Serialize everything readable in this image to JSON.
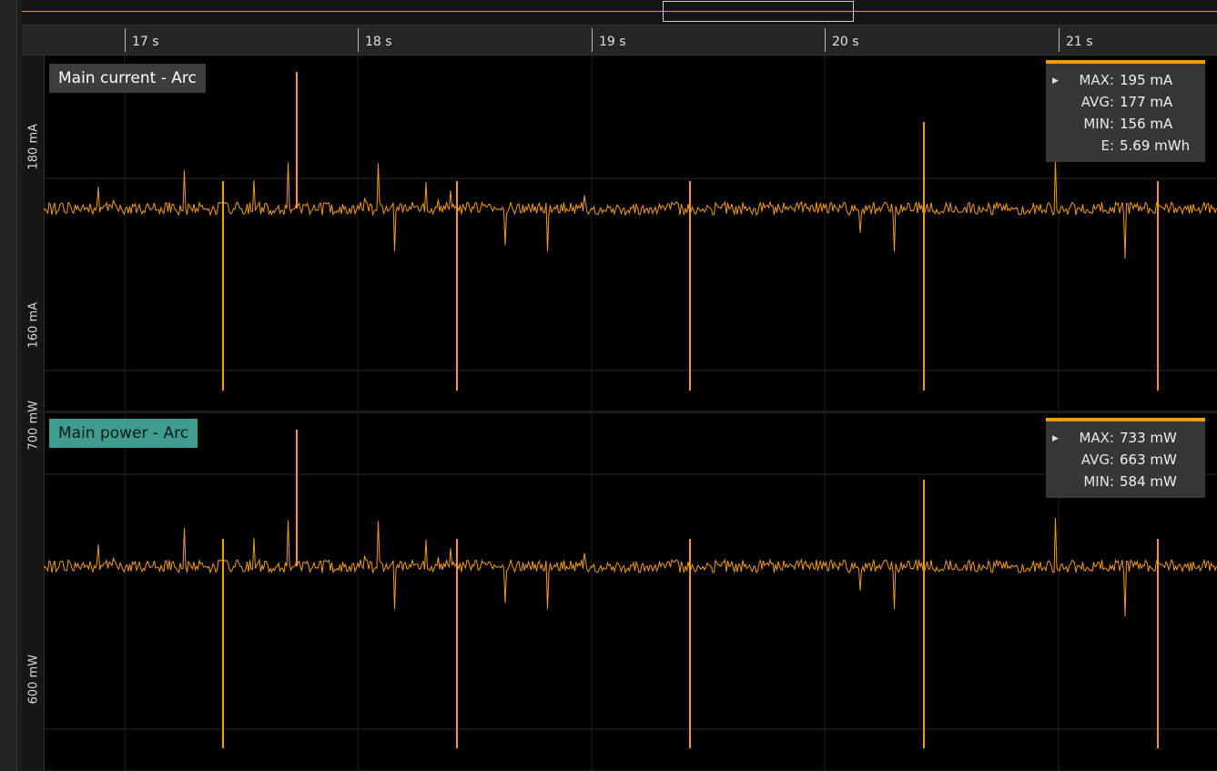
{
  "timeline": {
    "ticks": [
      "17 s",
      "18 s",
      "19 s",
      "20 s",
      "21 s"
    ]
  },
  "panels": [
    {
      "title": "Main current - Arc",
      "y_labels": [
        "180 mA",
        "160 mA"
      ],
      "stats": [
        {
          "key": "MAX:",
          "value": "195 mA"
        },
        {
          "key": "AVG:",
          "value": "177 mA"
        },
        {
          "key": "MIN:",
          "value": "156 mA"
        },
        {
          "key": "E:",
          "value": "5.69 mWh"
        }
      ]
    },
    {
      "title": "Main power - Arc",
      "y_labels": [
        "700 mW",
        "600 mW"
      ],
      "stats": [
        {
          "key": "MAX:",
          "value": "733 mW"
        },
        {
          "key": "AVG:",
          "value": "663 mW"
        },
        {
          "key": "MIN:",
          "value": "584 mW"
        }
      ]
    }
  ],
  "colors": {
    "trace": "#f39b12",
    "power_badge": "#3f9c8e",
    "current_badge": "#3d3d3d"
  },
  "icons": {
    "stats_expand": "triangle-right-icon"
  }
}
